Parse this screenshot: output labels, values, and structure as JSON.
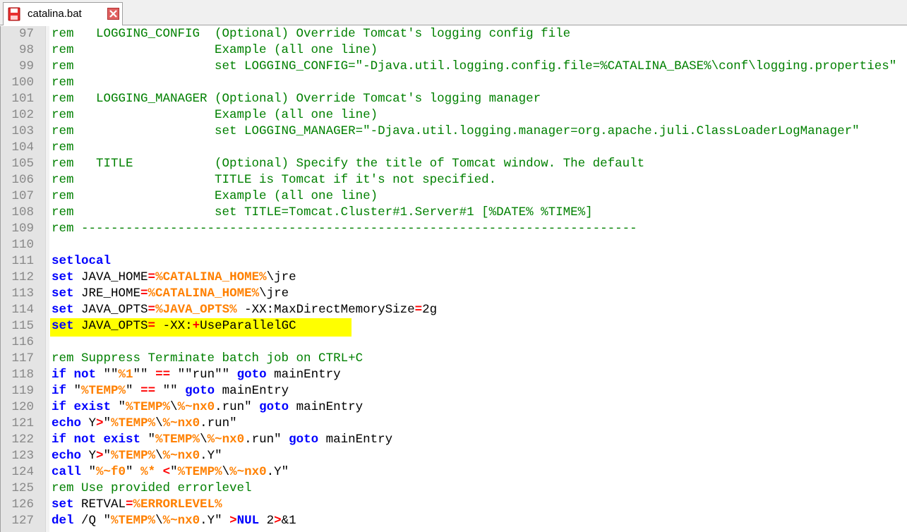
{
  "tab": {
    "filename": "catalina.bat"
  },
  "editor": {
    "highlight_line": 115,
    "lines": [
      {
        "n": "97",
        "seg": [
          [
            "c",
            "rem   LOGGING_CONFIG  (Optional) Override Tomcat's logging config file"
          ]
        ]
      },
      {
        "n": "98",
        "seg": [
          [
            "c",
            "rem                   Example (all one line)"
          ]
        ]
      },
      {
        "n": "99",
        "seg": [
          [
            "c",
            "rem                   set LOGGING_CONFIG=\"-Djava.util.logging.config.file=%CATALINA_BASE%\\conf\\logging.properties\""
          ]
        ]
      },
      {
        "n": "100",
        "seg": [
          [
            "c",
            "rem"
          ]
        ]
      },
      {
        "n": "101",
        "seg": [
          [
            "c",
            "rem   LOGGING_MANAGER (Optional) Override Tomcat's logging manager"
          ]
        ]
      },
      {
        "n": "102",
        "seg": [
          [
            "c",
            "rem                   Example (all one line)"
          ]
        ]
      },
      {
        "n": "103",
        "seg": [
          [
            "c",
            "rem                   set LOGGING_MANAGER=\"-Djava.util.logging.manager=org.apache.juli.ClassLoaderLogManager\""
          ]
        ]
      },
      {
        "n": "104",
        "seg": [
          [
            "c",
            "rem"
          ]
        ]
      },
      {
        "n": "105",
        "seg": [
          [
            "c",
            "rem   TITLE           (Optional) Specify the title of Tomcat window. The default"
          ]
        ]
      },
      {
        "n": "106",
        "seg": [
          [
            "c",
            "rem                   TITLE is Tomcat if it's not specified."
          ]
        ]
      },
      {
        "n": "107",
        "seg": [
          [
            "c",
            "rem                   Example (all one line)"
          ]
        ]
      },
      {
        "n": "108",
        "seg": [
          [
            "c",
            "rem                   set TITLE=Tomcat.Cluster#1.Server#1 [%DATE% %TIME%]"
          ]
        ]
      },
      {
        "n": "109",
        "seg": [
          [
            "c",
            "rem ---------------------------------------------------------------------------"
          ]
        ]
      },
      {
        "n": "110",
        "seg": []
      },
      {
        "n": "111",
        "seg": [
          [
            "k",
            "setlocal"
          ]
        ]
      },
      {
        "n": "112",
        "seg": [
          [
            "k",
            "set"
          ],
          [
            "p",
            " JAVA_HOME"
          ],
          [
            "o",
            "="
          ],
          [
            "v",
            "%CATALINA_HOME%"
          ],
          [
            "p",
            "\\jre"
          ]
        ]
      },
      {
        "n": "113",
        "seg": [
          [
            "k",
            "set"
          ],
          [
            "p",
            " JRE_HOME"
          ],
          [
            "o",
            "="
          ],
          [
            "v",
            "%CATALINA_HOME%"
          ],
          [
            "p",
            "\\jre"
          ]
        ]
      },
      {
        "n": "114",
        "seg": [
          [
            "k",
            "set"
          ],
          [
            "p",
            " JAVA_OPTS"
          ],
          [
            "o",
            "="
          ],
          [
            "v",
            "%JAVA_OPTS%"
          ],
          [
            "p",
            " -XX:MaxDirectMemorySize"
          ],
          [
            "o",
            "="
          ],
          [
            "p",
            "2g"
          ]
        ]
      },
      {
        "n": "115",
        "seg": [
          [
            "k",
            "set"
          ],
          [
            "p",
            " JAVA_OPTS"
          ],
          [
            "o",
            "="
          ],
          [
            "p",
            " -XX:"
          ],
          [
            "o",
            "+"
          ],
          [
            "p",
            "UseParallelGC"
          ]
        ]
      },
      {
        "n": "116",
        "seg": []
      },
      {
        "n": "117",
        "seg": [
          [
            "c",
            "rem Suppress Terminate batch job on CTRL+C"
          ]
        ]
      },
      {
        "n": "118",
        "seg": [
          [
            "k",
            "if not"
          ],
          [
            "s",
            " \"\""
          ],
          [
            "v",
            "%1"
          ],
          [
            "s",
            "\"\" "
          ],
          [
            "o",
            "=="
          ],
          [
            "s",
            " \"\"run\"\" "
          ],
          [
            "k",
            "goto"
          ],
          [
            "p",
            " mainEntry"
          ]
        ]
      },
      {
        "n": "119",
        "seg": [
          [
            "k",
            "if"
          ],
          [
            "s",
            " \""
          ],
          [
            "v",
            "%TEMP%"
          ],
          [
            "s",
            "\" "
          ],
          [
            "o",
            "=="
          ],
          [
            "s",
            " \"\" "
          ],
          [
            "k",
            "goto"
          ],
          [
            "p",
            " mainEntry"
          ]
        ]
      },
      {
        "n": "120",
        "seg": [
          [
            "k",
            "if exist"
          ],
          [
            "s",
            " \""
          ],
          [
            "v",
            "%TEMP%"
          ],
          [
            "s",
            "\\"
          ],
          [
            "v",
            "%~nx0"
          ],
          [
            "s",
            ".run\" "
          ],
          [
            "k",
            "goto"
          ],
          [
            "p",
            " mainEntry"
          ]
        ]
      },
      {
        "n": "121",
        "seg": [
          [
            "k",
            "echo"
          ],
          [
            "p",
            " Y"
          ],
          [
            "o",
            ">"
          ],
          [
            "s",
            "\""
          ],
          [
            "v",
            "%TEMP%"
          ],
          [
            "s",
            "\\"
          ],
          [
            "v",
            "%~nx0"
          ],
          [
            "s",
            ".run\""
          ]
        ]
      },
      {
        "n": "122",
        "seg": [
          [
            "k",
            "if not exist"
          ],
          [
            "s",
            " \""
          ],
          [
            "v",
            "%TEMP%"
          ],
          [
            "s",
            "\\"
          ],
          [
            "v",
            "%~nx0"
          ],
          [
            "s",
            ".run\" "
          ],
          [
            "k",
            "goto"
          ],
          [
            "p",
            " mainEntry"
          ]
        ]
      },
      {
        "n": "123",
        "seg": [
          [
            "k",
            "echo"
          ],
          [
            "p",
            " Y"
          ],
          [
            "o",
            ">"
          ],
          [
            "s",
            "\""
          ],
          [
            "v",
            "%TEMP%"
          ],
          [
            "s",
            "\\"
          ],
          [
            "v",
            "%~nx0"
          ],
          [
            "s",
            ".Y\""
          ]
        ]
      },
      {
        "n": "124",
        "seg": [
          [
            "k",
            "call"
          ],
          [
            "s",
            " \""
          ],
          [
            "v",
            "%~f0"
          ],
          [
            "s",
            "\" "
          ],
          [
            "v",
            "%*"
          ],
          [
            "p",
            " "
          ],
          [
            "o",
            "<"
          ],
          [
            "s",
            "\""
          ],
          [
            "v",
            "%TEMP%"
          ],
          [
            "s",
            "\\"
          ],
          [
            "v",
            "%~nx0"
          ],
          [
            "s",
            ".Y\""
          ]
        ]
      },
      {
        "n": "125",
        "seg": [
          [
            "c",
            "rem Use provided errorlevel"
          ]
        ]
      },
      {
        "n": "126",
        "seg": [
          [
            "k",
            "set"
          ],
          [
            "p",
            " RETVAL"
          ],
          [
            "o",
            "="
          ],
          [
            "v",
            "%ERRORLEVEL%"
          ]
        ]
      },
      {
        "n": "127",
        "seg": [
          [
            "k",
            "del"
          ],
          [
            "p",
            " /Q "
          ],
          [
            "s",
            "\""
          ],
          [
            "v",
            "%TEMP%"
          ],
          [
            "s",
            "\\"
          ],
          [
            "v",
            "%~nx0"
          ],
          [
            "s",
            ".Y\" "
          ],
          [
            "o",
            ">"
          ],
          [
            "k",
            "NUL"
          ],
          [
            "p",
            " 2"
          ],
          [
            "o",
            ">"
          ],
          [
            "p",
            "&1"
          ]
        ]
      }
    ]
  },
  "colors": {
    "comment": "#008000",
    "keyword": "#0000ff",
    "variable": "#ff8000",
    "operator": "#ff0000",
    "highlight": "#ffff00",
    "gutter_bg": "#e4e4e4",
    "line_number": "#888888"
  },
  "icons": {
    "tab_icon": "save-disk-icon",
    "close_icon": "close-x-icon"
  }
}
